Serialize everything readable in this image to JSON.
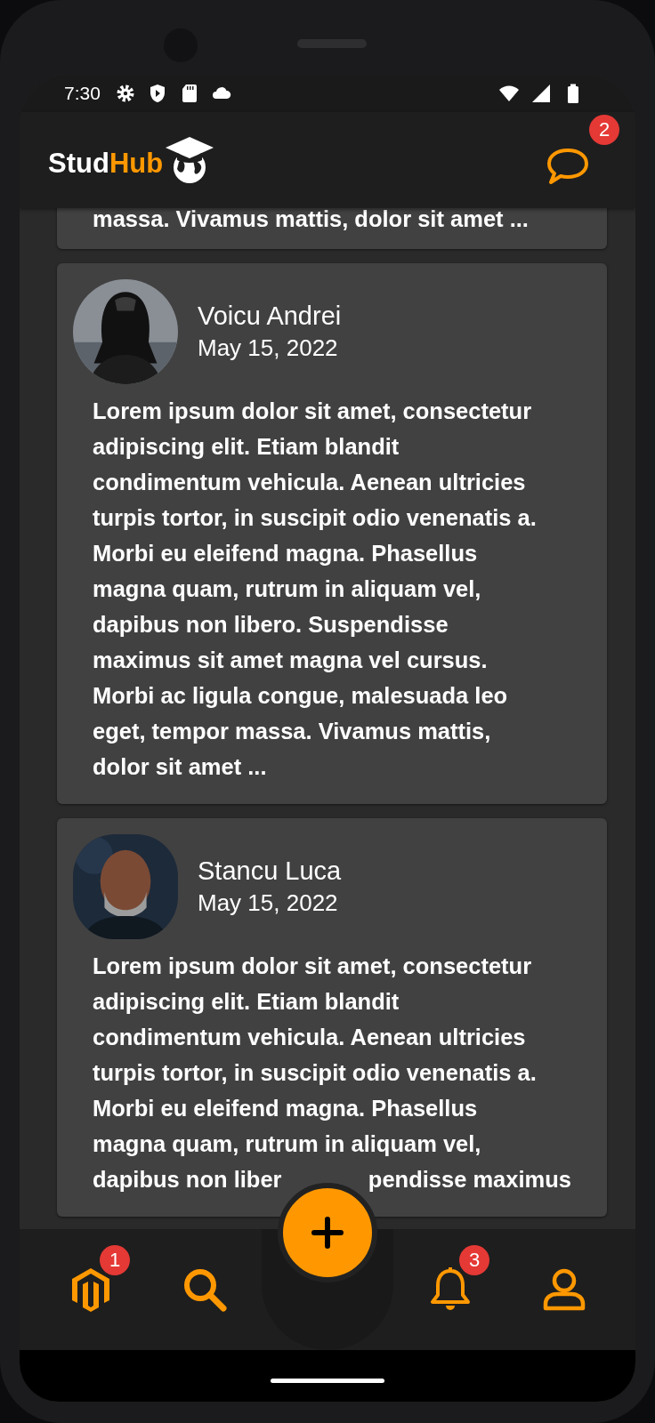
{
  "status_bar": {
    "time": "7:30"
  },
  "app_bar": {
    "logo": {
      "first": "Stud",
      "second": "Hub"
    },
    "messages_badge": "2"
  },
  "posts": [
    {
      "kind": "tail",
      "text": "massa. Vivamus mattis, dolor sit amet ..."
    },
    {
      "author": "Voicu Andrei",
      "date": "May 15, 2022",
      "kind": "circle",
      "avatar": {
        "kind": "picture"
      },
      "text": "Lorem ipsum dolor sit amet, consectetur adipiscing elit. Etiam blandit condimentum vehicula. Aenean ultricies turpis tortor, in suscipit odio venenatis a. Morbi eu eleifend magna. Phasellus magna quam, rutrum in aliquam vel, dapibus non libero. Suspendisse maximus sit amet magna vel cursus. Morbi ac ligula congue, malesuada leo eget, tempor massa. Vivamus mattis, dolor sit amet ..."
    },
    {
      "author": "Stancu Luca",
      "date": "May 15, 2022",
      "kind": "rounded",
      "avatar": {
        "kind": "picture"
      },
      "text": "Lorem ipsum dolor sit amet, consectetur adipiscing elit. Etiam blandit condimentum vehicula. Aenean ultricies turpis tortor, in suscipit odio venenatis a. Morbi eu eleifend magna. Phasellus magna quam, rutrum in aliquam vel,",
      "covered_line": [
        "dapibus non liber",
        "pendisse maximus"
      ]
    }
  ],
  "bottom_nav": [
    {
      "kind": "hexagon",
      "badge": "1"
    },
    {
      "kind": "search"
    },
    {
      "kind": "add"
    },
    {
      "kind": "bell",
      "badge": "3"
    },
    {
      "kind": "profile"
    }
  ]
}
